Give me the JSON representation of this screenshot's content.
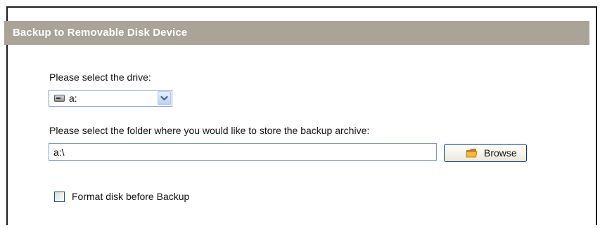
{
  "panel": {
    "title": "Backup to Removable Disk Device"
  },
  "drive": {
    "label": "Please select the drive:",
    "selected_value": "a:",
    "icon": "drive-icon"
  },
  "folder": {
    "label": "Please select the folder where you would like to store the backup archive:",
    "path_value": "a:\\",
    "browse_label": "Browse",
    "browse_icon": "folder-icon"
  },
  "options": {
    "format_label": "Format disk before Backup",
    "format_checked": false
  },
  "colors": {
    "header_bg": "#a9a398",
    "header_text": "#ffffff",
    "input_border": "#7f9db9"
  }
}
